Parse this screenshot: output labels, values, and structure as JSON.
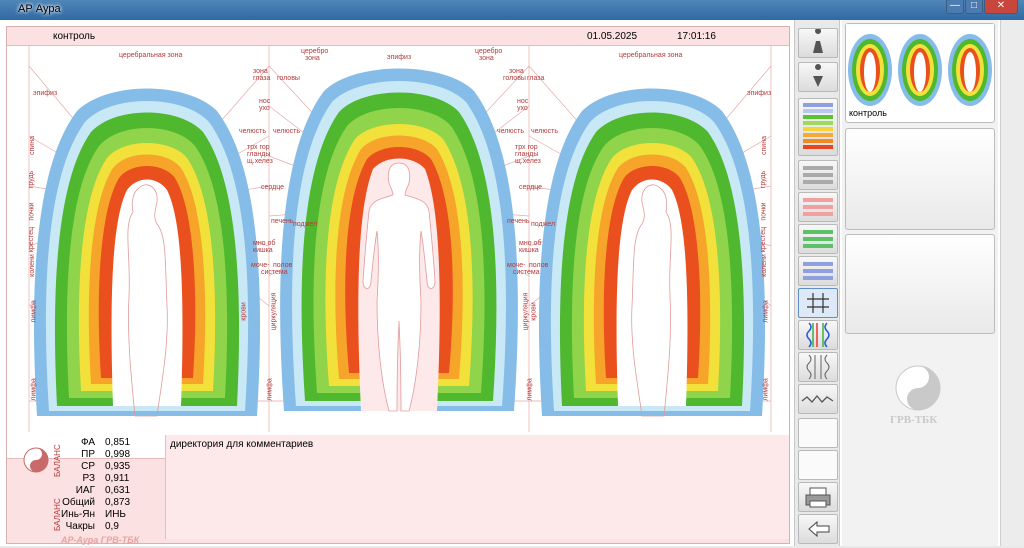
{
  "window": {
    "title": "АР Аура",
    "min_label": "—",
    "max_label": "□",
    "close_label": "✕"
  },
  "header": {
    "label": "контроль",
    "date": "01.05.2025",
    "time": "17:01:16"
  },
  "zones": {
    "cerebral_left": "церебральная зона",
    "cerebral_right": "церебральная зона",
    "cerebro_1": "церебро",
    "zona": "зона",
    "cerebro_2": "церебро",
    "zona_2": "зона",
    "epifiz_center": "эпифиз",
    "epifiz_left": "эпифиз",
    "epifiz_right": "эпифиз",
    "zona_golovy_l": "зона",
    "golovy_l": "головы",
    "glaza_l": "глаза",
    "zona_golovy_r": "зона",
    "golovy_r": "головы",
    "glaza_r": "глаза",
    "nos_l": "нос",
    "uho_l": "ухо",
    "nos_r": "нос",
    "uho_r": "ухо",
    "chelyust_l1": "челюсть",
    "chelyust_l2": "челюсть",
    "chelyust_r1": "челюсть",
    "chelyust_r2": "челюсть",
    "trh_gor_l": "трх гор",
    "glandy_l": "гланды",
    "shchel_l": "щ.хелез",
    "trh_gor_r": "трх гор",
    "glandy_r": "гланды",
    "shchel_r": "щ.хелез",
    "serdce_l": "сердце",
    "serdce_r": "сердце",
    "pechen_l": "печень",
    "pechen_r": "печень",
    "podzh_l": "поджел",
    "podzh_r": "поджел",
    "mn_ob_l": "мно об",
    "mn_ob_r": "мно об",
    "kishka_l": "кишка",
    "kishka_r": "кишка",
    "mnochelez_l": "моче-",
    "mnochelez_r": "моче-",
    "polo_l": "полов",
    "polo_r": "полов",
    "sistema_l": "система",
    "sistema_r": "система",
    "cirk_l": "циркуляция",
    "cirk_r": "циркуляция",
    "krovi_l": "крови",
    "krovi_r": "крови",
    "limfa_1": "лимфа",
    "limfa_2": "лимфа",
    "limfa_3": "лимфа",
    "limfa_4": "лимфа",
    "side_l1": "спина",
    "side_l2": "грудь",
    "side_l3": "почки",
    "side_l4": "крестец",
    "side_l5": "колени",
    "side_l6": "лимфа",
    "side_r1": "спина",
    "side_r2": "грудь",
    "side_r3": "почки",
    "side_r4": "крестец",
    "side_r5": "колени",
    "side_r6": "лимфа"
  },
  "stats": {
    "balance_label_1": "БАЛАНС",
    "balance_label_2": "БАЛАНС",
    "rows": [
      {
        "label": "ФА",
        "value": "0,851"
      },
      {
        "label": "ПР",
        "value": "0,998"
      },
      {
        "label": "СР",
        "value": "0,935"
      },
      {
        "label": "РЗ",
        "value": "0,911"
      },
      {
        "label": "ИАГ",
        "value": "0,631"
      },
      {
        "label": "Общий",
        "value": "0,873"
      },
      {
        "label": "Инь-Ян",
        "value": "ИНЬ"
      },
      {
        "label": "Чакры",
        "value": "0,9"
      }
    ]
  },
  "comments": {
    "text": "директория для комментариев"
  },
  "footer_brand": "АР-Аура ГРВ-ТБК",
  "thumbnail": {
    "label": "контроль"
  },
  "logo_text": "ГРВ-ТБК",
  "icons": {
    "person_up": "person-up-icon",
    "person_down": "person-down-icon",
    "palette_full": "palette-full-icon",
    "palette_grey": "palette-grey-icon",
    "palette_pink": "palette-pink-icon",
    "palette_green": "palette-green-icon",
    "palette_blue": "palette-blue-icon",
    "grid": "grid-icon",
    "waves_color": "waves-color-icon",
    "waves_grey": "waves-grey-icon",
    "zigzag": "zigzag-icon",
    "printer": "printer-icon",
    "back": "back-arrow-icon"
  },
  "colors": {
    "accent_red": "#b33a3a",
    "aura_blue": "#7fb7e8",
    "aura_green": "#5bc236",
    "aura_yellow": "#f5d33a",
    "aura_orange": "#f08a24",
    "aura_red": "#e8461e"
  }
}
